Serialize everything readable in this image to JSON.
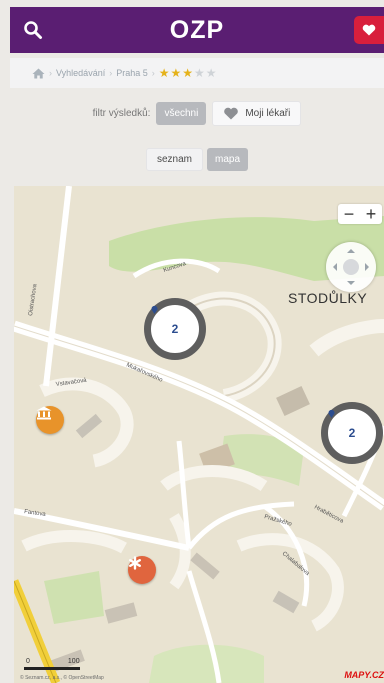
{
  "header": {
    "logo": "OZP"
  },
  "breadcrumb": {
    "items": [
      "Vyhledávání",
      "Praha 5"
    ],
    "rating": {
      "filled": 3,
      "total": 5
    }
  },
  "filter": {
    "label": "filtr výsledků:",
    "all_label": "všechni",
    "my_doctors_label": "Moji lékaři"
  },
  "view_toggle": {
    "list_label": "seznam",
    "map_label": "mapa"
  },
  "map": {
    "place_label": "STODŮLKY",
    "streets": [
      "Kuncova",
      "Oistrachova",
      "Mukařovského",
      "Vstavačová",
      "Fantova",
      "Pražského",
      "Hraběticova",
      "Chalabalova"
    ],
    "zoom_in": "+",
    "zoom_out": "−",
    "clusters": [
      {
        "count": "2"
      },
      {
        "count": "2"
      }
    ],
    "scale_labels": [
      "0",
      "100"
    ],
    "attribution": "© Seznam.cz, a.s., © OpenStreetMap",
    "provider_logo": "MAPY.CZ"
  },
  "colors": {
    "header": "#5a1e72",
    "heart_badge": "#d81f3c",
    "cluster_ring": "#5e5e5e",
    "poi_pharmacy": "#e8932a",
    "poi_medical": "#e0653e"
  },
  "icons": {
    "header_search": "search-icon",
    "header_heart": "heart-icon",
    "breadcrumb_home": "home-icon",
    "poi_pharmacy": "institution-icon",
    "poi_medical": "medical-cross-icon"
  }
}
